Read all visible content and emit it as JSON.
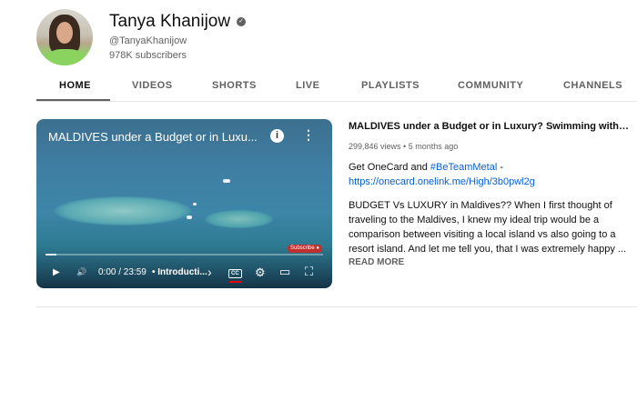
{
  "channel": {
    "name": "Tanya Khanijow",
    "handle": "@TanyaKhanijow",
    "subscribers": "978K subscribers",
    "verified_icon": "check-circle"
  },
  "tabs": [
    {
      "label": "HOME",
      "active": true
    },
    {
      "label": "VIDEOS"
    },
    {
      "label": "SHORTS"
    },
    {
      "label": "LIVE"
    },
    {
      "label": "PLAYLISTS"
    },
    {
      "label": "COMMUNITY"
    },
    {
      "label": "CHANNELS"
    }
  ],
  "player": {
    "title": "MALDIVES under a Budget or in Luxu...",
    "info_icon": "i",
    "more_icon": "⋮",
    "subscribe_badge": "Subscribe ●",
    "time": "0:00 / 23:59",
    "chapter": "• Introducti...",
    "chapter_arrow": "›",
    "cc_label": "CC",
    "progress": 0,
    "icons": {
      "play": "▶",
      "volume": "🔊",
      "settings": "⚙",
      "cast": "▭",
      "fullscreen": "⛶"
    }
  },
  "video": {
    "title": "MALDIVES under a Budget or in Luxury? Swimming with sharks",
    "meta": "299,846 views • 5 months ago",
    "promo_prefix": "Get OneCard and ",
    "promo_hashtag": "#BeTeamMetal",
    "promo_suffix": " -",
    "promo_link": "https://onecard.onelink.me/High/3b0pwl2g",
    "description": "BUDGET Vs LUXURY in Maldives?? When I first thought of traveling to the Maldives, I knew my ideal trip would be a comparison between visiting a local island vs also going to a resort island. And let me tell you, that I was extremely happy ...",
    "read_more": "READ MORE"
  },
  "colors": {
    "link": "#065fd4",
    "cc_active": "#e00000",
    "subscribe": "#c0302e"
  }
}
